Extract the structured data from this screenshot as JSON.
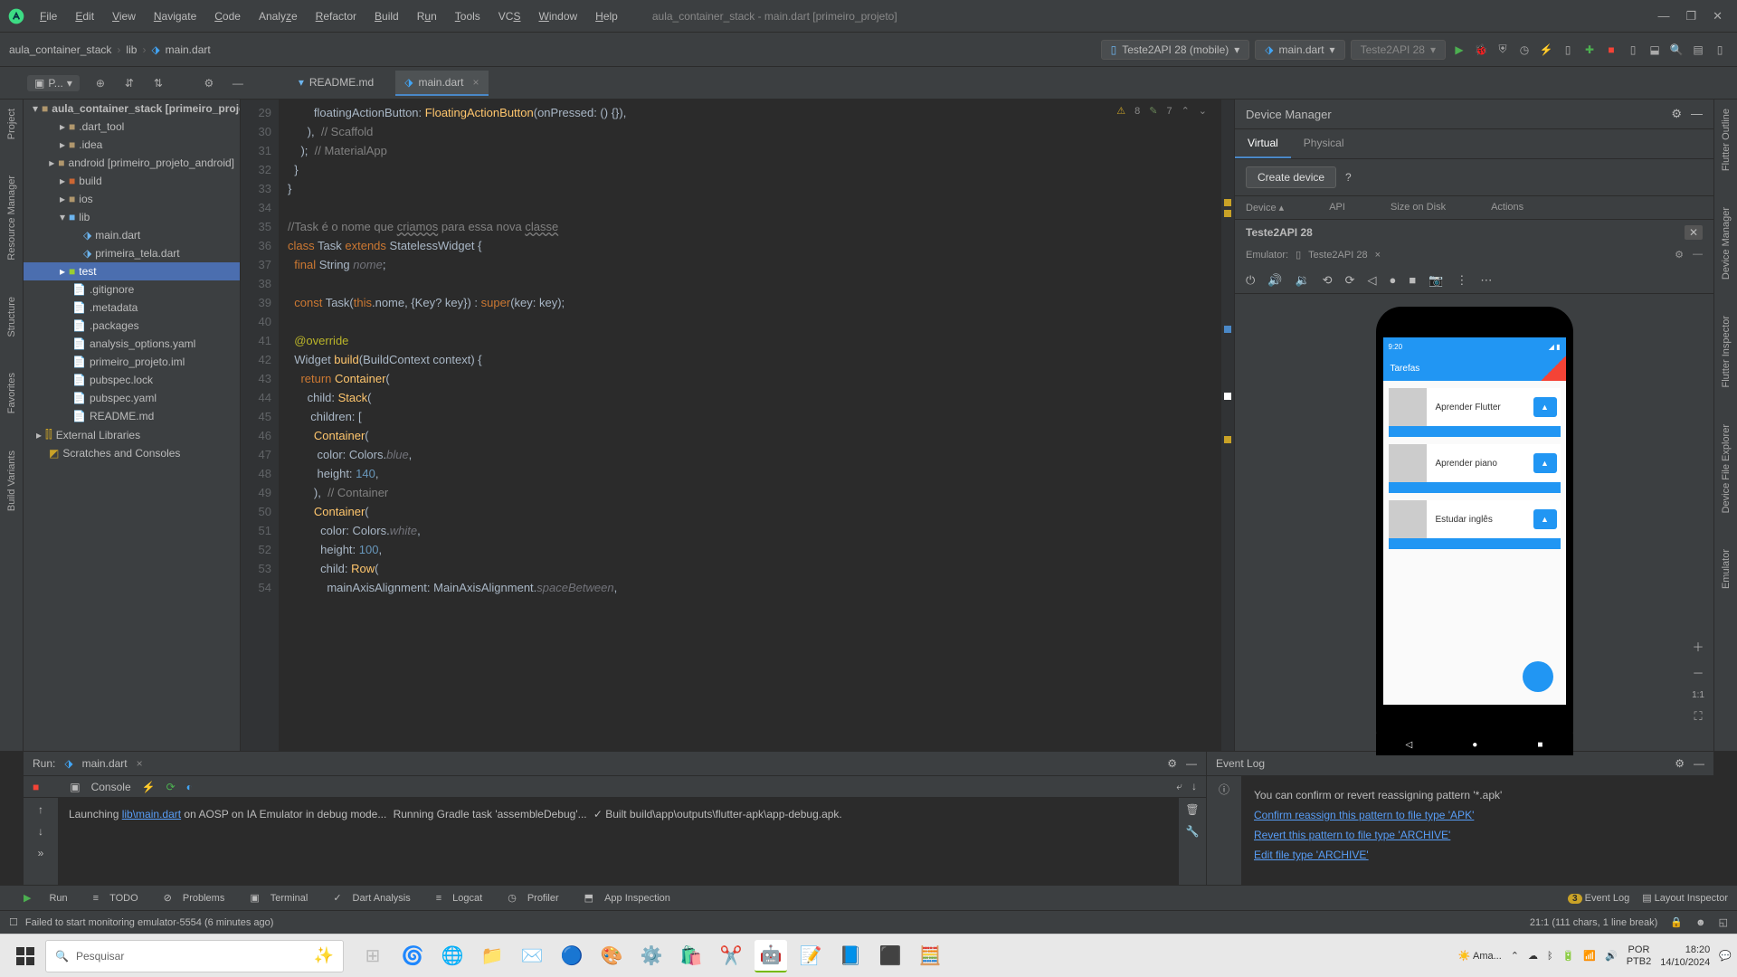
{
  "window": {
    "title": "aula_container_stack - main.dart [primeiro_projeto]"
  },
  "menu": [
    "File",
    "Edit",
    "View",
    "Navigate",
    "Code",
    "Analyze",
    "Refactor",
    "Build",
    "Run",
    "Tools",
    "VCS",
    "Window",
    "Help"
  ],
  "breadcrumbs": [
    "aula_container_stack",
    "lib",
    "main.dart"
  ],
  "toolbar": {
    "device": "Teste2API 28 (mobile)",
    "config": "main.dart",
    "exec_target": "Teste2API 28"
  },
  "tabs": {
    "readme": "README.md",
    "main": "main.dart"
  },
  "left_tools": [
    "Project",
    "Resource Manager",
    "Structure",
    "Favorites",
    "Build Variants"
  ],
  "right_tools": [
    "Flutter Outline",
    "Device Manager",
    "Flutter Inspector",
    "Device File Explorer",
    "Emulator"
  ],
  "tree": {
    "root": "aula_container_stack [primeiro_projeto]",
    "dart_tool": ".dart_tool",
    "idea": ".idea",
    "android": "android [primeiro_projeto_android]",
    "build": "build",
    "ios": "ios",
    "lib": "lib",
    "main_dart": "main.dart",
    "primeira_tela": "primeira_tela.dart",
    "test": "test",
    "gitignore": ".gitignore",
    "metadata": ".metadata",
    "packages": ".packages",
    "analysis": "analysis_options.yaml",
    "iml": "primeiro_projeto.iml",
    "pubspec_lock": "pubspec.lock",
    "pubspec_yaml": "pubspec.yaml",
    "readme": "README.md",
    "ext_lib": "External Libraries",
    "scratches": "Scratches and Consoles"
  },
  "editor": {
    "warnings": "8",
    "hints": "7",
    "line_start": 29
  },
  "device_mgr": {
    "title": "Device Manager",
    "tab_virtual": "Virtual",
    "tab_physical": "Physical",
    "create": "Create device",
    "col_device": "Device",
    "col_api": "API",
    "col_size": "Size on Disk",
    "col_actions": "Actions",
    "device_name": "Teste2API 28",
    "emulator_label": "Emulator:",
    "emulator_name": "Teste2API 28",
    "zoom": "1:1"
  },
  "phone": {
    "time": "9:20",
    "appbar": "Tarefas",
    "task1": "Aprender Flutter",
    "task2": "Aprender piano",
    "task3": "Estudar inglês"
  },
  "run": {
    "label": "Run:",
    "tab": "main.dart",
    "console": "Console",
    "line1_a": "Launching ",
    "line1_link": "lib\\main.dart",
    "line1_b": " on AOSP on IA Emulator in debug mode...",
    "line2": "Running Gradle task 'assembleDebug'...",
    "line3": "✓  Built build\\app\\outputs\\flutter-apk\\app-debug.apk."
  },
  "event": {
    "title": "Event Log",
    "msg": "You can confirm or revert reassigning pattern '*.apk'",
    "link1": "Confirm reassign this pattern to file type 'APK'",
    "link2": "Revert this pattern to file type 'ARCHIVE'",
    "link3": "Edit file type 'ARCHIVE'"
  },
  "bottom_tabs": {
    "run": "Run",
    "todo": "TODO",
    "problems": "Problems",
    "terminal": "Terminal",
    "dart": "Dart Analysis",
    "logcat": "Logcat",
    "profiler": "Profiler",
    "inspection": "App Inspection",
    "event_log": "Event Log",
    "event_badge": "3",
    "layout": "Layout Inspector"
  },
  "infobar": {
    "msg": "Failed to start monitoring emulator-5554 (6 minutes ago)",
    "caret": "21:1 (111 chars, 1 line break)"
  },
  "taskbar": {
    "search": "Pesquisar",
    "weather": "Ama...",
    "lang1": "POR",
    "lang2": "PTB2",
    "time": "18:20",
    "date": "14/10/2024"
  }
}
